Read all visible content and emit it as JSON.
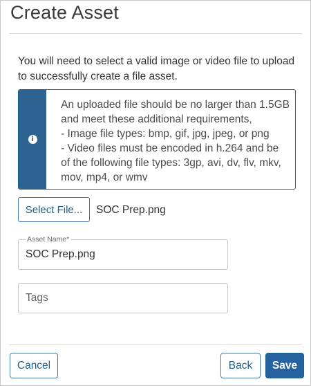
{
  "dialog": {
    "title": "Create Asset",
    "intro_line1": "You will need to select a valid image or video file to upload",
    "intro_line2": "to successfully create a file asset.",
    "info": {
      "icon": "info-icon",
      "lines": [
        "An uploaded file should be no larger than 1.5GB",
        "and meet these additional requirements,",
        "- Image file types: bmp, gif, jpg, jpeg, or png",
        "- Video files must be encoded in h.264 and be",
        "of the following file types: 3gp, avi, dv, flv, mkv,",
        "mov, mp4, or wmv"
      ]
    },
    "select_file_label": "Select File...",
    "selected_file_name": "SOC Prep.png",
    "asset_name": {
      "label": "Asset Name*",
      "value": "SOC Prep.png"
    },
    "tags": {
      "placeholder": "Tags",
      "value": ""
    },
    "buttons": {
      "cancel": "Cancel",
      "back": "Back",
      "save": "Save"
    }
  },
  "colors": {
    "accent": "#2762a0",
    "info_bar": "#2e6290",
    "border": "#c7c7c7"
  }
}
